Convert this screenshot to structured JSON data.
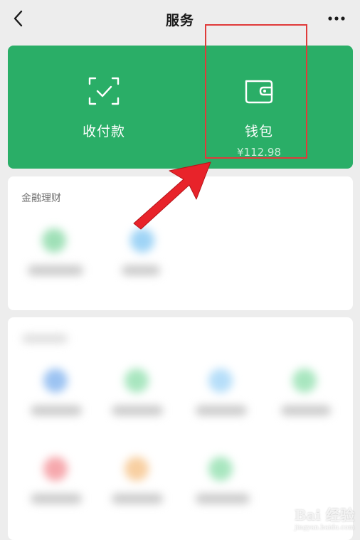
{
  "nav": {
    "title": "服务",
    "back_icon": "chevron-left-icon",
    "more_icon": "more-dots-icon"
  },
  "pay_card": {
    "background": "#2aae67",
    "items": [
      {
        "label": "收付款",
        "icon": "scan-check-icon"
      },
      {
        "label": "钱包",
        "icon": "wallet-icon",
        "balance": "¥112.98"
      }
    ],
    "highlight_color": "#e03a3a"
  },
  "sections": {
    "finance": {
      "title": "金融理财"
    }
  },
  "annotation": {
    "arrow_color": "#e8232a"
  },
  "watermark": {
    "text": "Bai 经验",
    "sub": "jingyan.baidu.com"
  }
}
